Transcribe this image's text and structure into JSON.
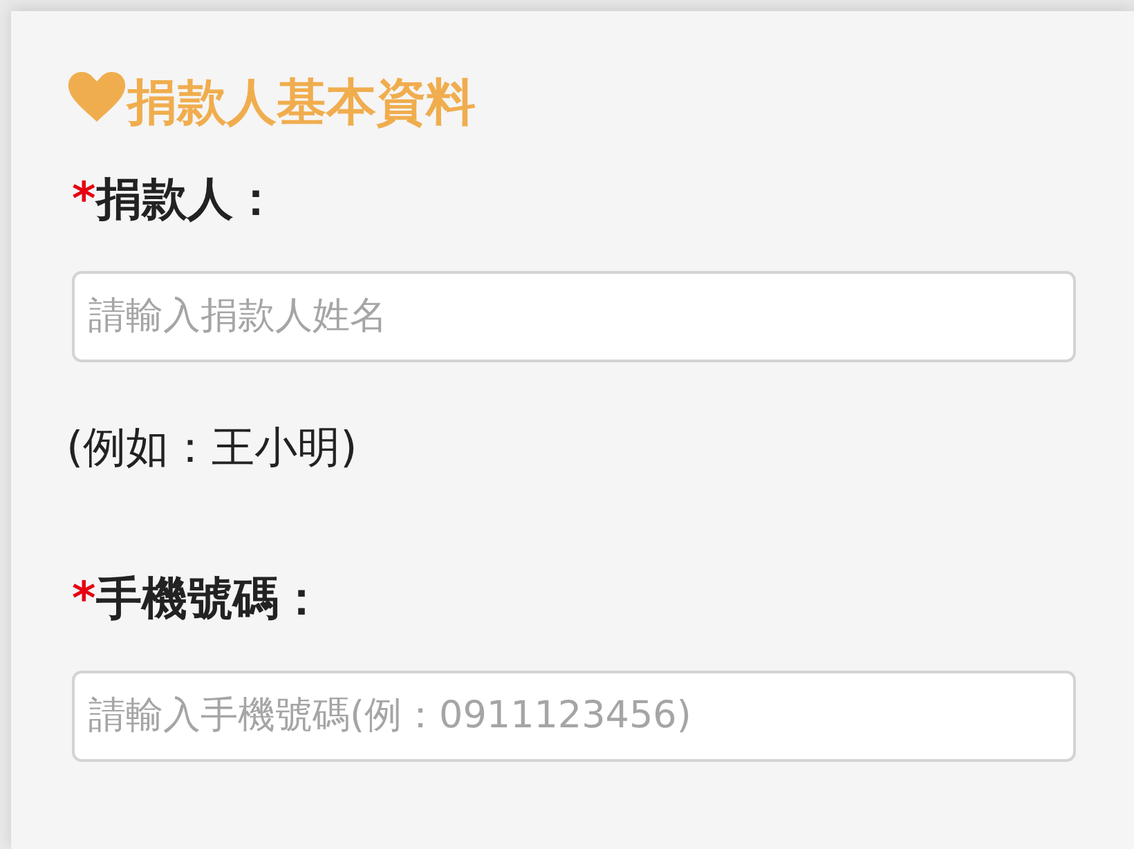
{
  "section": {
    "title": "捐款人基本資料"
  },
  "fields": [
    {
      "required_mark": "*",
      "label": "捐款人：",
      "placeholder": "請輸入捐款人姓名",
      "hint": "(例如：王小明)"
    },
    {
      "required_mark": "*",
      "label": "手機號碼：",
      "placeholder": "請輸入手機號碼(例：0911123456)"
    }
  ]
}
